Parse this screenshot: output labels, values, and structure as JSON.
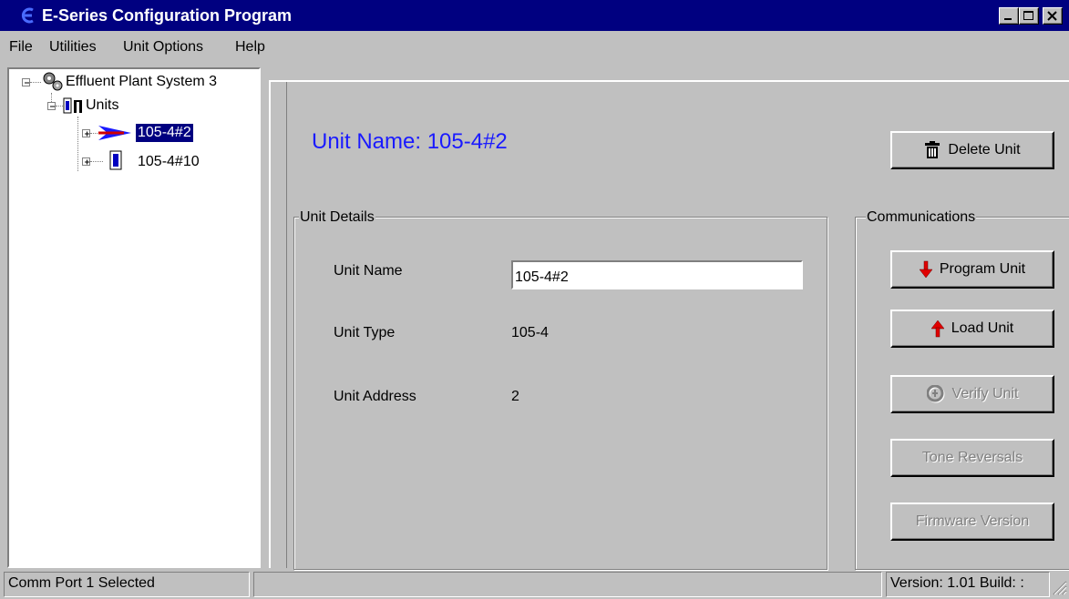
{
  "window": {
    "title": "E-Series Configuration Program",
    "colors": {
      "titlebar": "#000080",
      "face": "#c0c0c0",
      "unit_title": "#1a1aff",
      "selection": "#000080"
    }
  },
  "menu": {
    "items": [
      "File",
      "Utilities",
      "Unit Options",
      "Help"
    ]
  },
  "tree": {
    "root": {
      "label": "Effluent Plant System 3",
      "icon": "gears-icon"
    },
    "units_node": {
      "label": "Units",
      "icon": "units-icon"
    },
    "units": [
      {
        "label": "105-4#2",
        "icon": "arrow-pointer-icon",
        "selected": true
      },
      {
        "label": "105-4#10",
        "icon": "unit-device-icon",
        "selected": false
      }
    ]
  },
  "main": {
    "unit_title": "Unit Name: 105-4#2",
    "delete_button": {
      "label": "Delete Unit",
      "icon": "trash-icon"
    },
    "details": {
      "group_label": "Unit Details",
      "unit_name_label": "Unit Name",
      "unit_name_value": "105-4#2",
      "unit_type_label": "Unit Type",
      "unit_type_value": "105-4",
      "unit_address_label": "Unit Address",
      "unit_address_value": "2"
    },
    "communications": {
      "group_label": "Communications",
      "buttons": [
        {
          "label": "Program Unit",
          "icon": "arrow-down-red-icon",
          "enabled": true
        },
        {
          "label": "Load Unit",
          "icon": "arrow-up-red-icon",
          "enabled": true
        },
        {
          "label": "Verify Unit",
          "icon": "verify-icon",
          "enabled": false
        },
        {
          "label": "Tone Reversals",
          "enabled": false
        },
        {
          "label": "Firmware Version",
          "enabled": false
        }
      ]
    }
  },
  "statusbar": {
    "left": "Comm Port 1 Selected",
    "middle": "",
    "right": "Version: 1.01 Build: :"
  }
}
